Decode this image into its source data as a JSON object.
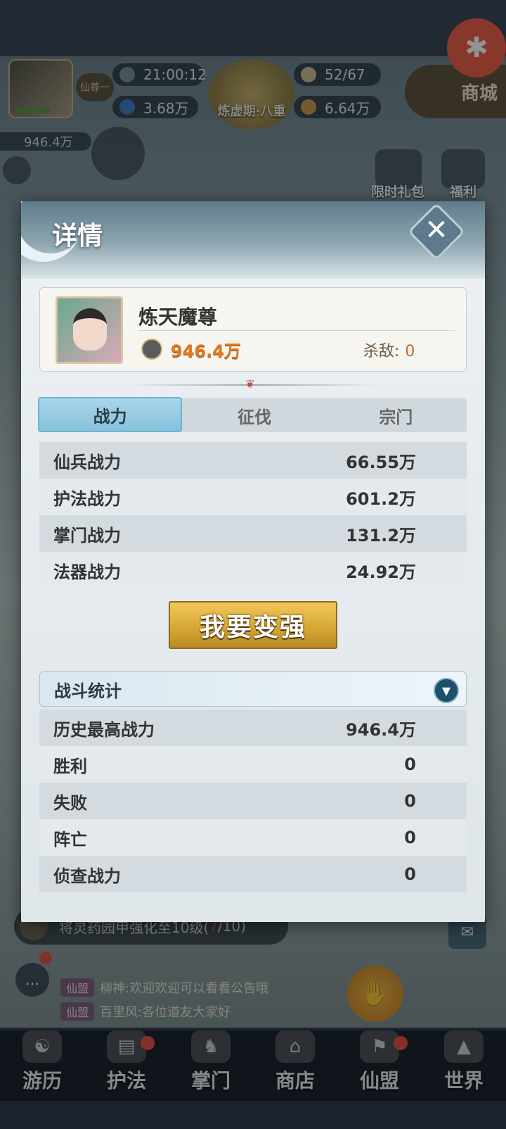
{
  "hud": {
    "rank": "仙尊一",
    "time": "21:00:12",
    "stamina": "52/67",
    "currency1": "3.68万",
    "currency2": "6.64万",
    "realm": "炼虚期·八重",
    "shop": "商城",
    "power_mini": "946.4万",
    "gift_label": "限时礼包",
    "welfare_label": "福利"
  },
  "modal": {
    "title": "详情",
    "close_icon": "close-icon"
  },
  "profile": {
    "name": "炼天魔尊",
    "power": "946.4万",
    "kill_label": "杀敌:",
    "kill_value": "0"
  },
  "tabs": [
    "战力",
    "征伐",
    "宗门"
  ],
  "power_stats": [
    {
      "label": "仙兵战力",
      "value": "66.55万"
    },
    {
      "label": "护法战力",
      "value": "601.2万"
    },
    {
      "label": "掌门战力",
      "value": "131.2万"
    },
    {
      "label": "法器战力",
      "value": "24.92万"
    }
  ],
  "strong_button": "我要变强",
  "battle": {
    "header": "战斗统计",
    "rows": [
      {
        "label": "历史最高战力",
        "value": "946.4万"
      },
      {
        "label": "胜利",
        "value": "0"
      },
      {
        "label": "失败",
        "value": "0"
      },
      {
        "label": "阵亡",
        "value": "0"
      },
      {
        "label": "侦查战力",
        "value": "0"
      }
    ]
  },
  "quest": {
    "text": "将灵药园甲强化至10级(",
    "progress": "7",
    "total": "/10)"
  },
  "chat": [
    {
      "tag": "仙盟",
      "text": "柳神:欢迎欢迎可以看看公告哦"
    },
    {
      "tag": "仙盟",
      "text": "百里风:各位道友大家好"
    }
  ],
  "nav": [
    {
      "label": "游历",
      "dot": false
    },
    {
      "label": "护法",
      "dot": true
    },
    {
      "label": "掌门",
      "dot": false
    },
    {
      "label": "商店",
      "dot": false
    },
    {
      "label": "仙盟",
      "dot": true
    },
    {
      "label": "世界",
      "dot": false
    }
  ],
  "colors": {
    "accent_gold": "#d7a532",
    "power_orange": "#e37a1f",
    "tab_active": "#86c1dc",
    "alert_red": "#e84c3d"
  }
}
